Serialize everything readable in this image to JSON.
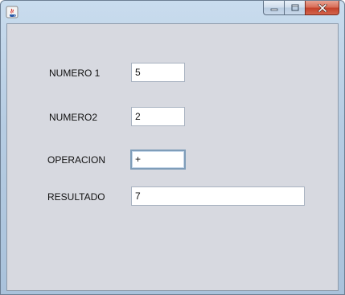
{
  "window": {
    "icon": "java-cup-icon",
    "controls": {
      "minimize_icon": "minimize-icon",
      "maximize_icon": "maximize-icon",
      "close_icon": "close-icon"
    }
  },
  "form": {
    "numero1": {
      "label": "NUMERO 1",
      "value": "5"
    },
    "numero2": {
      "label": "NUMERO2",
      "value": "2"
    },
    "operacion": {
      "label": "OPERACION",
      "value": "+"
    },
    "resultado": {
      "label": "RESULTADO",
      "value": "7"
    }
  },
  "colors": {
    "panel_background": "#d7d9e0",
    "field_background": "#ffffff",
    "focus_border": "#7f9db9",
    "close_button": "#c4422b"
  }
}
